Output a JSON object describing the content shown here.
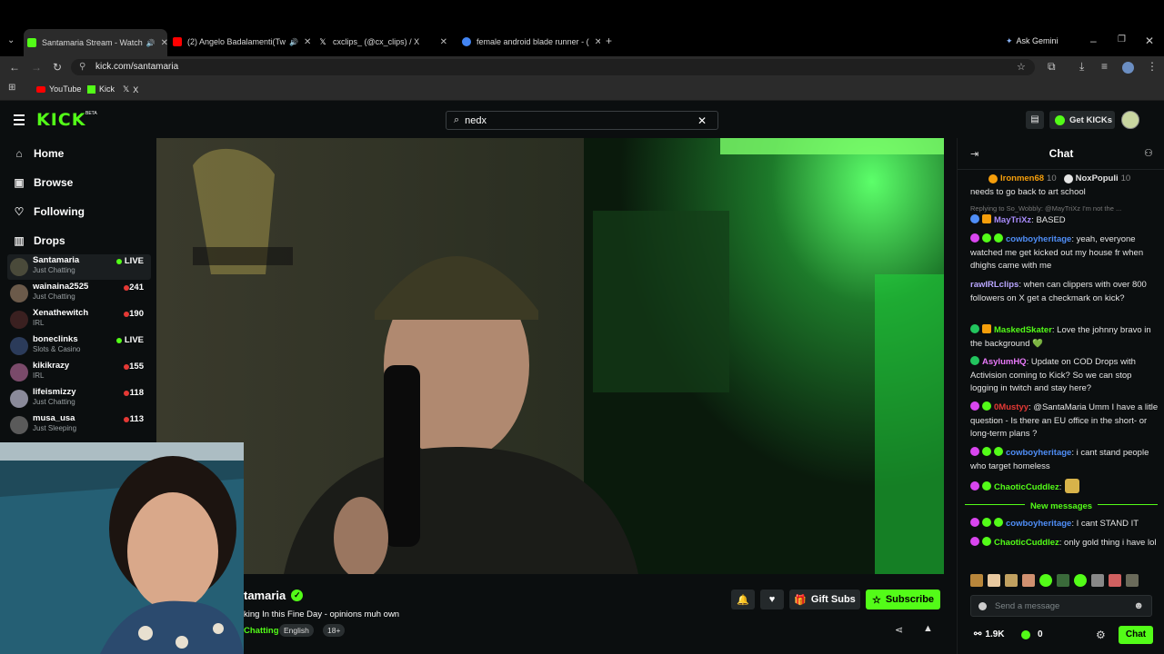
{
  "browser": {
    "tabs": [
      {
        "title": "Santamaria Stream - Watch",
        "active": true,
        "favicon_color": "#53fc18"
      },
      {
        "title": "(2) Angelo Badalamenti(Tw",
        "active": false,
        "favicon_color": "#ff0000"
      },
      {
        "title": "cxclips_ (@cx_clips) / X",
        "active": false,
        "favicon_color": "#ffffff"
      },
      {
        "title": "female android blade runner - (",
        "active": false,
        "favicon_color": "#4285f4"
      }
    ],
    "new_tab_icon": "plus-icon",
    "ask_gemini": "Ask Gemini",
    "url": "kick.com/santamaria",
    "bookmarks": [
      {
        "label": "YouTube",
        "color": "#ff0000"
      },
      {
        "label": "Kick",
        "color": "#53fc18"
      },
      {
        "label": "X",
        "color": "#ffffff"
      }
    ]
  },
  "header": {
    "logo": "KICK",
    "logo_badge": "BETA",
    "search_value": "nedx",
    "get_kicks": "Get KICKs",
    "accent": "#53fc18"
  },
  "sidebar": {
    "nav": [
      {
        "label": "Home",
        "icon": "home-icon"
      },
      {
        "label": "Browse",
        "icon": "browse-icon"
      },
      {
        "label": "Following",
        "icon": "heart-icon"
      },
      {
        "label": "Drops",
        "icon": "drops-icon"
      }
    ],
    "channels": [
      {
        "name": "Santamaria",
        "category": "Just Chatting",
        "count": "LIVE",
        "green": true
      },
      {
        "name": "wainaina2525",
        "category": "Just Chatting",
        "count": "241",
        "green": false
      },
      {
        "name": "Xenathewitch",
        "category": "IRL",
        "count": "190",
        "green": false
      },
      {
        "name": "boneclinks",
        "category": "Slots & Casino",
        "count": "LIVE",
        "green": true
      },
      {
        "name": "kikikrazy",
        "category": "IRL",
        "count": "155",
        "green": false
      },
      {
        "name": "lifeismizzy",
        "category": "Just Chatting",
        "count": "118",
        "green": false
      },
      {
        "name": "musa_usa",
        "category": "Just Sleeping",
        "count": "113",
        "green": false
      }
    ]
  },
  "stream": {
    "name_partial": "tamaria",
    "title_partial": "king In this Fine Day - opinions muh own",
    "category_partial": "Chatting",
    "tags": [
      "English",
      "18+"
    ],
    "gift_subs": "Gift Subs",
    "subscribe": "Subscribe"
  },
  "chat": {
    "title": "Chat",
    "top_users": [
      {
        "name": "Ironmen68",
        "count": "10"
      },
      {
        "name": "NoxPopuli",
        "count": "10"
      }
    ],
    "messages": [
      {
        "user": "",
        "text": "needs to go back to art school",
        "color": "#e5e5e5"
      },
      {
        "reply": "Replying to So_Wobbly: @MayTriXz I'm not the ..."
      },
      {
        "user": "MayTriXz",
        "text": ": BASED",
        "color": "#a78bfa"
      },
      {
        "user": "cowboyheritage",
        "text": ": yeah, everyone watched me get kicked out my house fr when dhighs came with me",
        "color": "#4f8ef7"
      },
      {
        "user": "rawIRLclips",
        "text": ": when can clippers with over 800 followers on X get a checkmark on kick?",
        "color": "#b9a6ff"
      },
      {
        "user": "MaskedSkater",
        "text": ": Love the johnny bravo in the background 💚",
        "color": "#53fc18"
      },
      {
        "user": "AsylumHQ",
        "text": ": Update on COD Drops with Activision coming to Kick? So we can stop logging in twitch and stay here?",
        "color": "#e879f9"
      },
      {
        "user": "0Mustyy",
        "text": ": @SantaMaria Umm I have a litle question - Is there an EU office in the short- or long-term plans ?",
        "color": "#e53935"
      },
      {
        "user": "cowboyheritage",
        "text": ": i cant stand people who target homeless",
        "color": "#4f8ef7"
      },
      {
        "user": "ChaoticCuddlez",
        "text": ":",
        "color": "#53fc18"
      },
      {
        "divider": "New messages"
      },
      {
        "user": "cowboyheritage",
        "text": ": I cant STAND IT",
        "color": "#4f8ef7"
      },
      {
        "user": "ChaoticCuddlez",
        "text": ": only gold thing i have lol",
        "color": "#53fc18"
      }
    ],
    "input_placeholder": "Send a message",
    "viewers": "1.9K",
    "kicks": "0",
    "chat_button": "Chat"
  }
}
